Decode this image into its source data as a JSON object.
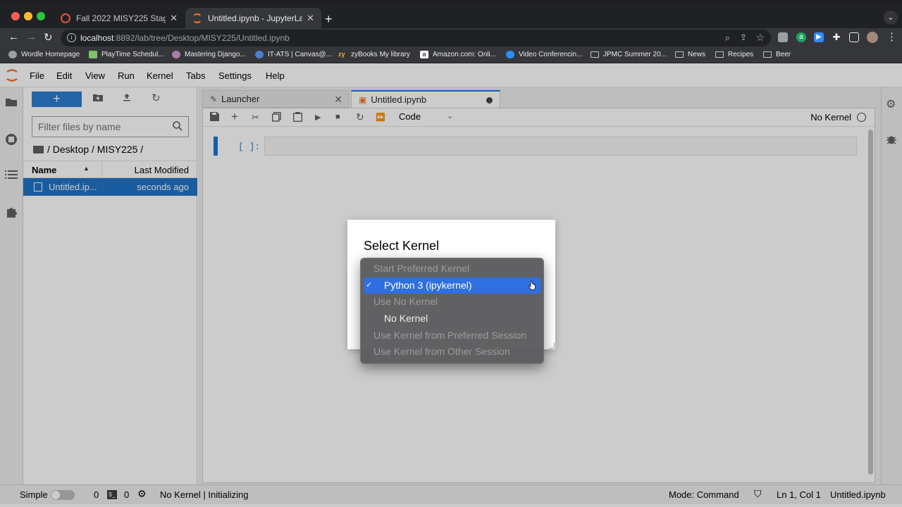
{
  "browser": {
    "tabs": [
      {
        "title": "Fall 2022 MISY225 Staging Site",
        "active": false
      },
      {
        "title": "Untitled.ipynb - JupyterLab",
        "active": true
      }
    ],
    "new_tab": "+",
    "url_host": "localhost",
    "url_rest": ":8892/lab/tree/Desktop/MISY225/Untitled.ipynb",
    "bookmarks": [
      "Wordle Homepage",
      "PlayTime Schedul...",
      "Mastering Django...",
      "IT-ATS | Canvas@...",
      "zyBooks My library",
      "Amazon.com: Onli...",
      "Video Conferencin...",
      "JPMC Summer 20...",
      "News",
      "Recipes",
      "Beer"
    ]
  },
  "menu": [
    "File",
    "Edit",
    "View",
    "Run",
    "Kernel",
    "Tabs",
    "Settings",
    "Help"
  ],
  "filebrowser": {
    "new_button": "+",
    "filter_placeholder": "Filter files by name",
    "breadcrumb": "/ Desktop / MISY225 /",
    "col_name": "Name",
    "col_modified": "Last Modified",
    "files": [
      {
        "name": "Untitled.ip...",
        "modified": "seconds ago"
      }
    ]
  },
  "doc_tabs": [
    {
      "label": "Launcher"
    },
    {
      "label": "Untitled.ipynb"
    }
  ],
  "notebook": {
    "cell_type": "Code",
    "kernel_name": "No Kernel",
    "prompt": "[ ]:"
  },
  "dialog": {
    "title": "Select Kernel",
    "options": [
      {
        "label": "Start Preferred Kernel",
        "kind": "header"
      },
      {
        "label": "Python 3 (ipykernel)",
        "kind": "selected"
      },
      {
        "label": "Use No Kernel",
        "kind": "header"
      },
      {
        "label": "No Kernel",
        "kind": "item"
      },
      {
        "label": "Use Kernel from Preferred Session",
        "kind": "header"
      },
      {
        "label": "Use Kernel from Other Session",
        "kind": "header"
      }
    ]
  },
  "status": {
    "mode_label": "Simple",
    "count_1": "0",
    "terminal_icon": "$_",
    "count_2": "0",
    "kernel_status": "No Kernel | Initializing",
    "mode": "Mode: Command",
    "cursor_pos": "Ln 1, Col 1",
    "filename": "Untitled.ipynb"
  },
  "colors": {
    "accent": "#1976d2",
    "jupyter_orange": "#f37726",
    "dropdown_selected": "#2f6fe0"
  }
}
